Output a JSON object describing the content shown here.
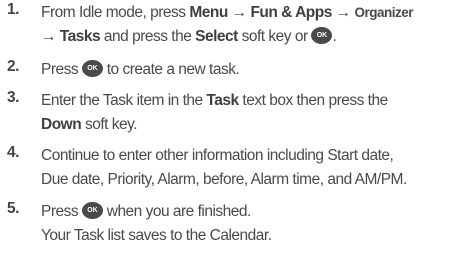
{
  "ok_key_label": "OK",
  "steps": [
    {
      "number": "1.",
      "parts": {
        "a": "From Idle mode, press ",
        "b": "Menu → Fun & Apps → ",
        "c": "Organizer",
        "d": "→ Tasks",
        "e": " and press the ",
        "f": "Select",
        "g": " soft key or ",
        "h": "."
      }
    },
    {
      "number": "2.",
      "parts": {
        "a": "Press ",
        "b": " to create a new task."
      }
    },
    {
      "number": "3.",
      "parts": {
        "a": "Enter the Task item in the ",
        "b": "Task",
        "c": " text box then press the",
        "d": "Down",
        "e": " soft key."
      }
    },
    {
      "number": "4.",
      "parts": {
        "a": "Continue to enter other information including Start date,",
        "b": "Due date, Priority, Alarm, before, Alarm time, and AM/PM."
      }
    },
    {
      "number": "5.",
      "parts": {
        "a": "Press ",
        "b": " when you are finished.",
        "c": "Your Task list saves to the Calendar."
      }
    }
  ]
}
